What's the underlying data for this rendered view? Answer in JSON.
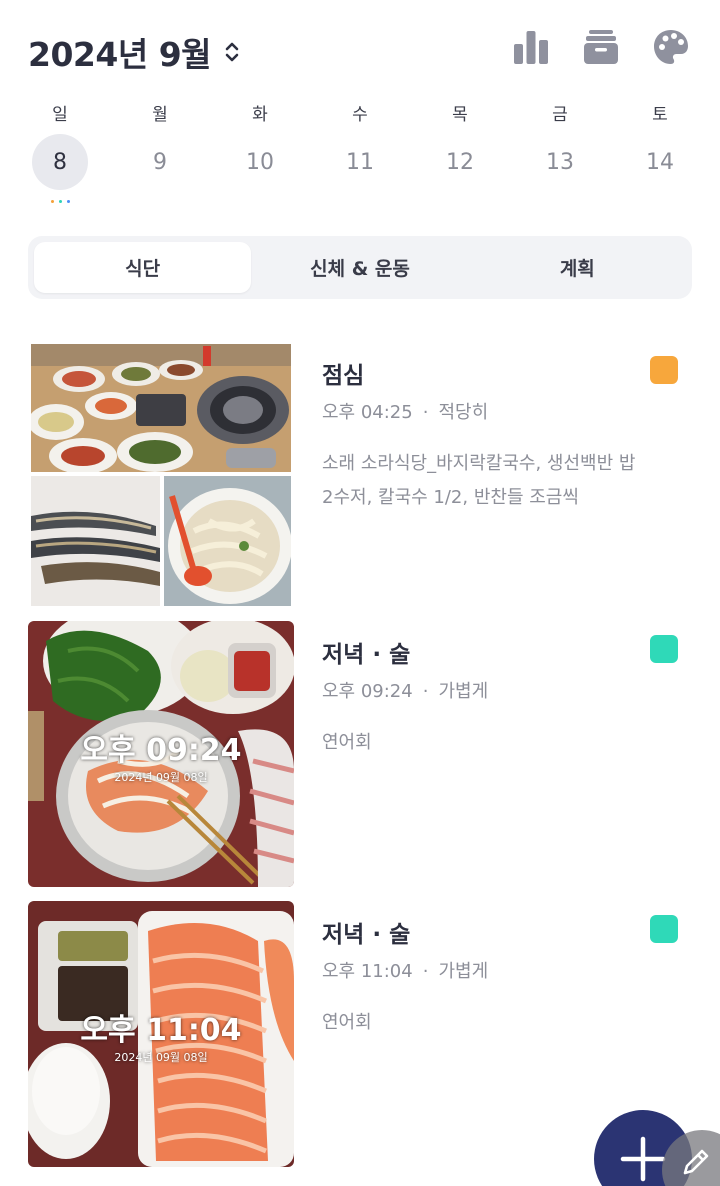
{
  "header": {
    "month_title": "2024년 9월",
    "icons": [
      "bar-chart-icon",
      "archive-box-icon",
      "palette-icon"
    ]
  },
  "week": {
    "days": [
      {
        "name": "일",
        "num": "8",
        "selected": true
      },
      {
        "name": "월",
        "num": "9"
      },
      {
        "name": "화",
        "num": "10"
      },
      {
        "name": "수",
        "num": "11"
      },
      {
        "name": "목",
        "num": "12"
      },
      {
        "name": "금",
        "num": "13"
      },
      {
        "name": "토",
        "num": "14"
      }
    ],
    "indicator_dot_colors": [
      "#f5a13a",
      "#2ed3b7",
      "#4d8ff7"
    ]
  },
  "tabs": {
    "diet": "식단",
    "body": "신체 & 운동",
    "plan": "계획",
    "active": "diet"
  },
  "meals": [
    {
      "title": "점심",
      "time": "오후 04:25",
      "amount": "적당히",
      "description": "소래 소라식당_바지락칼국수, 생선백반 밥 2수저, 칼국수 1/2, 반찬들 조금씩",
      "tag_color": "#f7a73c"
    },
    {
      "title": "저녁 · 술",
      "time": "오후 09:24",
      "amount": "가볍게",
      "description": "연어회",
      "tag_color": "#2fd9b8",
      "photo_stamp_time": "오후 09:24",
      "photo_stamp_date": "2024년 09월 08일"
    },
    {
      "title": "저녁 · 술",
      "time": "오후 11:04",
      "amount": "가볍게",
      "description": "연어회",
      "tag_color": "#2fd9b8",
      "photo_stamp_time": "오후 11:04",
      "photo_stamp_date": "2024년 09월 08일"
    }
  ],
  "fab": {
    "icon": "plus-icon"
  },
  "edit": {
    "icon": "pencil-icon"
  },
  "colors": {
    "primary_dark": "#2b3473",
    "text_dark": "#2c2f3f",
    "text_muted": "#8d8f99",
    "segment_bg": "#f2f3f6"
  }
}
